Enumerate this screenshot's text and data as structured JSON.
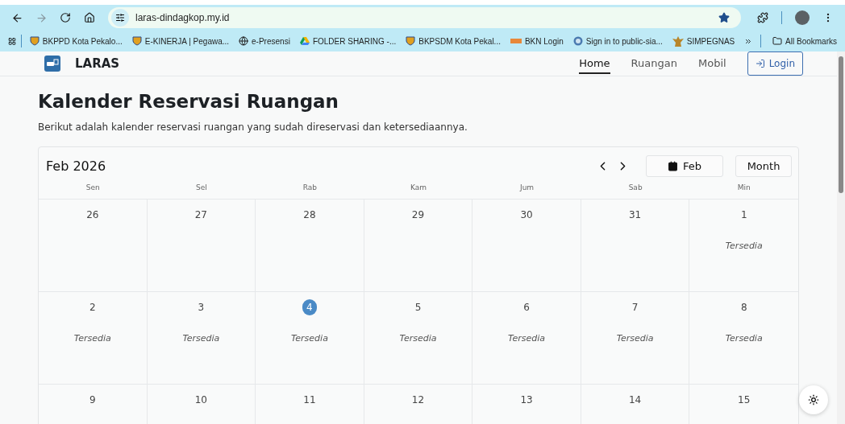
{
  "browser": {
    "url": "laras-dindagkop.my.id",
    "forward_disabled": true,
    "bookmarked": true,
    "bookmarks": [
      {
        "label": "BKPPD Kota Pekalo...",
        "kind": "shield"
      },
      {
        "label": "E-KINERJA | Pegawa...",
        "kind": "shield"
      },
      {
        "label": "e-Presensi",
        "kind": "globe"
      },
      {
        "label": "FOLDER SHARING -...",
        "kind": "drive"
      },
      {
        "label": "BKPSDM Kota Pekal...",
        "kind": "shield"
      },
      {
        "label": "BKN Login",
        "kind": "bkn"
      },
      {
        "label": "Sign in to public-sia...",
        "kind": "portal"
      },
      {
        "label": "SIMPEGNAS",
        "kind": "emblem"
      }
    ],
    "all_bookmarks": "All Bookmarks"
  },
  "app": {
    "brand": "LARAS",
    "nav": [
      {
        "label": "Home",
        "selected": true
      },
      {
        "label": "Ruangan",
        "selected": false
      },
      {
        "label": "Mobil",
        "selected": false
      }
    ],
    "login": "Login"
  },
  "page": {
    "title": "Kalender Reservasi Ruangan",
    "subtitle": "Berikut adalah kalender reservasi ruangan yang sudah direservasi dan ketersediaannya."
  },
  "calendar": {
    "month_label": "Feb 2026",
    "today_button": "Feb",
    "view_button": "Month",
    "weekdays": [
      "Sen",
      "Sel",
      "Rab",
      "Kam",
      "Jum",
      "Sab",
      "Min"
    ],
    "weeks": [
      [
        {
          "day": "26",
          "today": false
        },
        {
          "day": "27",
          "today": false
        },
        {
          "day": "28",
          "today": false
        },
        {
          "day": "29",
          "today": false
        },
        {
          "day": "30",
          "today": false
        },
        {
          "day": "31",
          "today": false
        },
        {
          "day": "1",
          "today": false,
          "status": "Tersedia"
        }
      ],
      [
        {
          "day": "2",
          "today": false,
          "status": "Tersedia"
        },
        {
          "day": "3",
          "today": false,
          "status": "Tersedia"
        },
        {
          "day": "4",
          "today": true,
          "status": "Tersedia"
        },
        {
          "day": "5",
          "today": false,
          "status": "Tersedia"
        },
        {
          "day": "6",
          "today": false,
          "status": "Tersedia"
        },
        {
          "day": "7",
          "today": false,
          "status": "Tersedia"
        },
        {
          "day": "8",
          "today": false,
          "status": "Tersedia"
        }
      ],
      [
        {
          "day": "9",
          "today": false
        },
        {
          "day": "10",
          "today": false
        },
        {
          "day": "11",
          "today": false
        },
        {
          "day": "12",
          "today": false
        },
        {
          "day": "13",
          "today": false
        },
        {
          "day": "14",
          "today": false
        },
        {
          "day": "15",
          "today": false
        }
      ]
    ]
  }
}
